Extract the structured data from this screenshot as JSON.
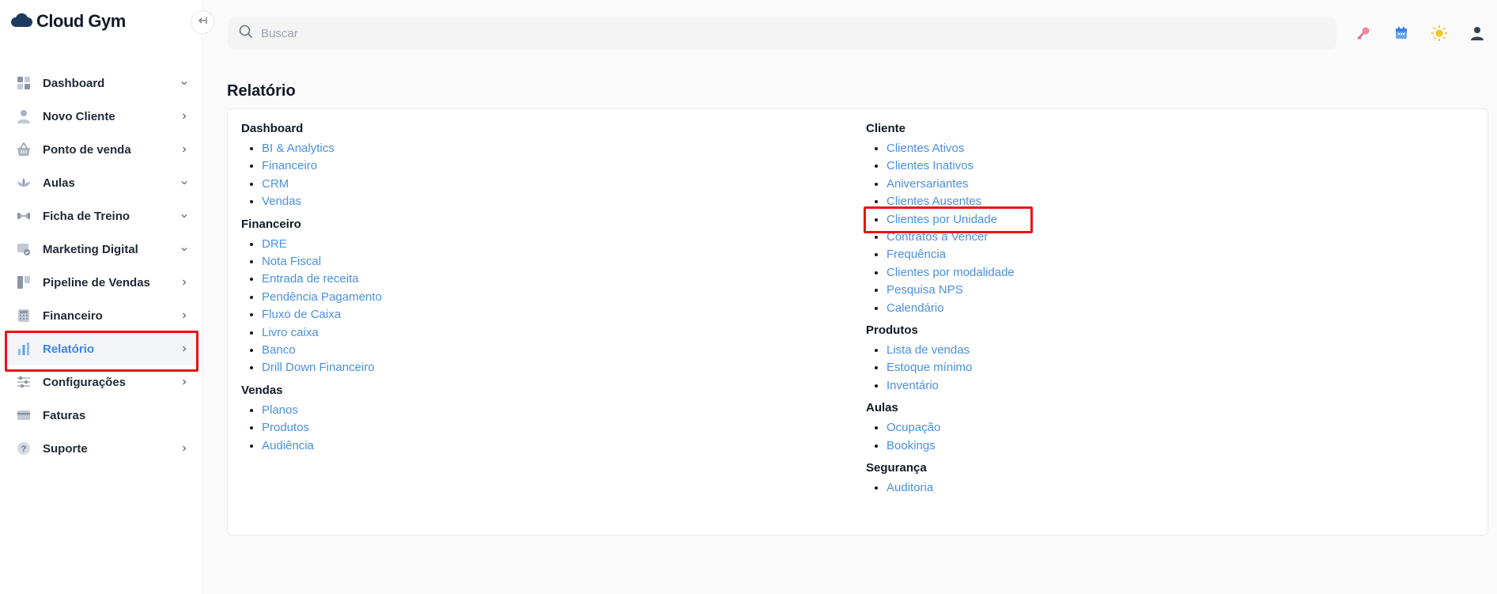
{
  "brand": {
    "name": "Cloud Gym"
  },
  "search": {
    "placeholder": "Buscar"
  },
  "sidebar": {
    "items": [
      {
        "label": "Dashboard",
        "icon": "dashboard-icon",
        "chevron": "down",
        "active": false
      },
      {
        "label": "Novo Cliente",
        "icon": "user-icon",
        "chevron": "right",
        "active": false
      },
      {
        "label": "Ponto de venda",
        "icon": "basket-icon",
        "chevron": "right",
        "active": false
      },
      {
        "label": "Aulas",
        "icon": "lotus-icon",
        "chevron": "down",
        "active": false
      },
      {
        "label": "Ficha de Treino",
        "icon": "dumbbell-icon",
        "chevron": "down",
        "active": false
      },
      {
        "label": "Marketing Digital",
        "icon": "marketing-icon",
        "chevron": "down",
        "active": false
      },
      {
        "label": "Pipeline de Vendas",
        "icon": "pipeline-icon",
        "chevron": "right",
        "active": false
      },
      {
        "label": "Financeiro",
        "icon": "calculator-icon",
        "chevron": "right",
        "active": false
      },
      {
        "label": "Relatório",
        "icon": "bar-chart-icon",
        "chevron": "right",
        "active": true
      },
      {
        "label": "Configurações",
        "icon": "sliders-icon",
        "chevron": "right",
        "active": false
      },
      {
        "label": "Faturas",
        "icon": "credit-card-icon",
        "chevron": "",
        "active": false
      },
      {
        "label": "Suporte",
        "icon": "help-icon",
        "chevron": "right",
        "active": false
      }
    ]
  },
  "page": {
    "title": "Relatório"
  },
  "report": {
    "left": [
      {
        "title": "Dashboard",
        "links": [
          "BI & Analytics",
          "Financeiro",
          "CRM",
          "Vendas"
        ]
      },
      {
        "title": "Financeiro",
        "links": [
          "DRE",
          "Nota Fiscal",
          "Entrada de receita",
          "Pendência Pagamento",
          "Fluxo de Caixa",
          "Livro caixa",
          "Banco",
          "Drill Down Financeiro"
        ]
      },
      {
        "title": "Vendas",
        "links": [
          "Planos",
          "Produtos",
          "Audiência"
        ]
      }
    ],
    "right": [
      {
        "title": "Cliente",
        "links": [
          "Clientes Ativos",
          "Clientes Inativos",
          "Aniversariantes",
          "Clientes Ausentes",
          "Clientes por Unidade",
          "Contratos a Vencer",
          "Frequência",
          "Clientes por modalidade",
          "Pesquisa NPS",
          "Calendário"
        ]
      },
      {
        "title": "Produtos",
        "links": [
          "Lista de vendas",
          "Estoque mínimo",
          "Inventário"
        ]
      },
      {
        "title": "Aulas",
        "links": [
          "Ocupação",
          "Bookings"
        ]
      },
      {
        "title": "Segurança",
        "links": [
          "Auditoria"
        ]
      }
    ]
  },
  "colors": {
    "accent": "#3b82f6",
    "link": "#4a90e2",
    "highlight": "#ee1111"
  }
}
